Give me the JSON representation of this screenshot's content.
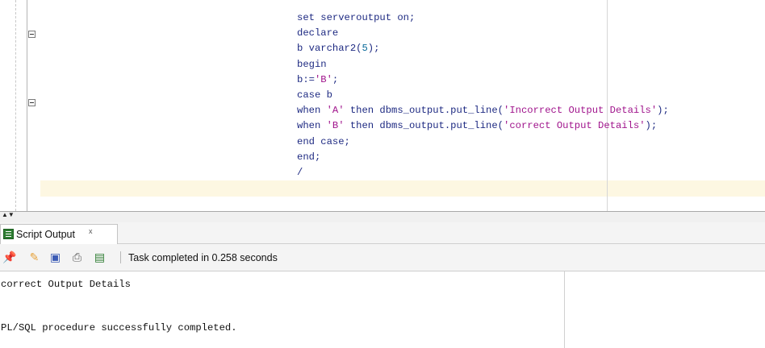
{
  "editor": {
    "code_lines": [
      [
        {
          "t": "set serveroutput on;"
        }
      ],
      [
        {
          "t": "declare"
        }
      ],
      [
        {
          "t": "b varchar2("
        },
        {
          "t": "5",
          "c": "num"
        },
        {
          "t": ");"
        }
      ],
      [
        {
          "t": "begin"
        }
      ],
      [
        {
          "t": "b:="
        },
        {
          "t": "'B'",
          "c": "str"
        },
        {
          "t": ";"
        }
      ],
      [
        {
          "t": "case b"
        }
      ],
      [
        {
          "t": "when "
        },
        {
          "t": "'A'",
          "c": "str"
        },
        {
          "t": " then dbms_output.put_line("
        },
        {
          "t": "'Incorrect Output Details'",
          "c": "str"
        },
        {
          "t": ");"
        }
      ],
      [
        {
          "t": "when "
        },
        {
          "t": "'B'",
          "c": "str"
        },
        {
          "t": " then dbms_output.put_line("
        },
        {
          "t": "'correct Output Details'",
          "c": "str"
        },
        {
          "t": ");"
        }
      ],
      [
        {
          "t": "end case;"
        }
      ],
      [
        {
          "t": "end;"
        }
      ],
      [
        {
          "t": "/"
        }
      ]
    ],
    "colors": {
      "keyword": "#1e2a82",
      "string": "#a0148c",
      "number": "#0a6a9a",
      "current_line": "#fdf7e2"
    }
  },
  "output_panel": {
    "tab_label": "Script Output",
    "tab_close": "x",
    "tab_icon": "script-output-icon",
    "toolbar": {
      "icons": [
        "pin-icon",
        "eraser-icon",
        "save-icon",
        "print-icon",
        "document-icon"
      ],
      "status": "Task completed in 0.258 seconds"
    },
    "lines": [
      "correct Output Details",
      "",
      "",
      "PL/SQL procedure successfully completed."
    ]
  }
}
